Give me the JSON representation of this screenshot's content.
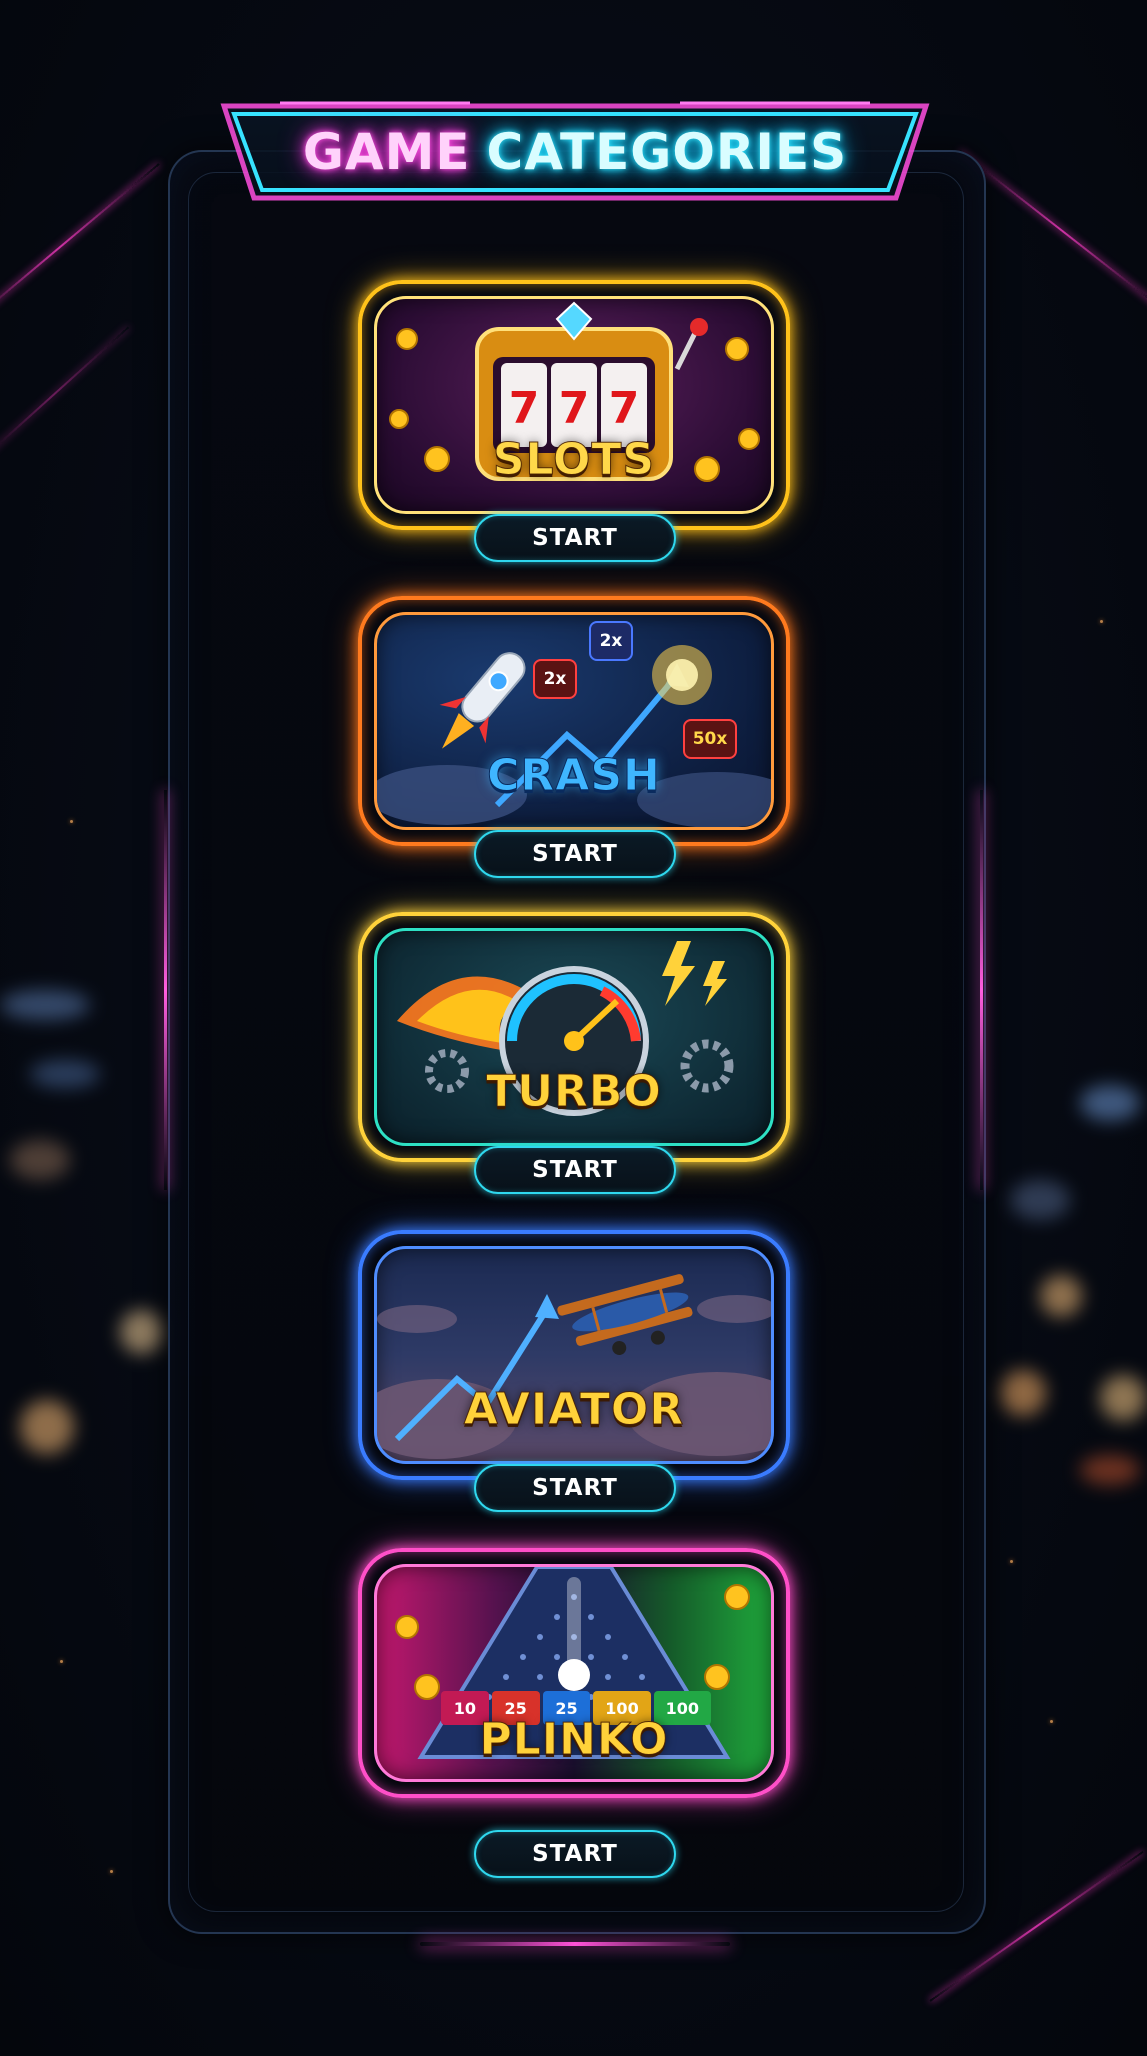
{
  "header": {
    "title_part1": "GAME",
    "title_part2": "CATEGORIES"
  },
  "games": [
    {
      "title": "SLOTS",
      "button_label": "START",
      "icon": "slot-machine-icon",
      "color": "#ffc21a"
    },
    {
      "title": "CRASH",
      "button_label": "START",
      "icon": "rocket-icon",
      "color": "#ff7a1e",
      "badges": [
        "2x",
        "2x",
        "50x"
      ]
    },
    {
      "title": "TURBO",
      "button_label": "START",
      "icon": "speedometer-icon",
      "color": "#ffd23a"
    },
    {
      "title": "AVIATOR",
      "button_label": "START",
      "icon": "biplane-icon",
      "color": "#3a7cff"
    },
    {
      "title": "PLINKO",
      "button_label": "START",
      "icon": "plinko-board-icon",
      "color": "#ff4fc8",
      "multipliers": [
        "10",
        "25",
        "25",
        "100",
        "100"
      ]
    }
  ]
}
